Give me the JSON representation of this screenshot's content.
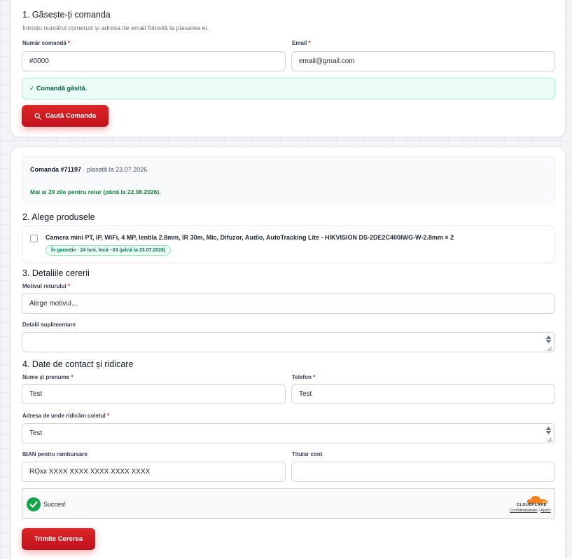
{
  "find_order": {
    "title": "1. Găsește-ți comanda",
    "hint": "Introdu numărul comenzii și adresa de email folosită la plasarea ei.",
    "order_label": "Număr comandă",
    "order_value": "#0000",
    "email_label": "Email",
    "email_value": "email@gmail.com",
    "required_mark": "*",
    "found_message": "✓ Comandă găsită.",
    "search_button": "Caută Comanda",
    "search_icon": "search-icon"
  },
  "order": {
    "title": "Comanda #71197",
    "placed": "· plasată la 23.07.2026",
    "return_window": "Mai ai 29 zile pentru retur (până la 22.08.2026)."
  },
  "products": {
    "title": "2. Alege produsele",
    "items": [
      {
        "name": "Camera mini PT, IP, WiFi, 4 MP, lentila 2.8mm, IR 30m, Mic, Difuzor, Audio, AutoTracking Lite - HIKVISION DS-2DE2C400IWG-W-2.8mm × 2",
        "warranty": "În garanție · 24 luni, încă ~24 (până la 23.07.2028)",
        "checked": false
      }
    ]
  },
  "request": {
    "title": "3. Detaliile cererii",
    "reason_label": "Motivul returului",
    "reason_value": "Alege motivul...",
    "details_label": "Detalii suplimentare",
    "details_value": ""
  },
  "contact": {
    "title": "4. Date de contact și ridicare",
    "name_label": "Nume și prenume",
    "name_value": "Test",
    "phone_label": "Telefon",
    "phone_value": "Test",
    "address_label": "Adresa de unde ridicăm coletul",
    "address_value": "Test",
    "iban_label": "IBAN pentru rambursare",
    "iban_placeholder": "ROxx XXXX XXXX XXXX XXXX XXXX",
    "holder_label": "Titular cont",
    "holder_value": ""
  },
  "captcha": {
    "status": "Succes!",
    "brand": "CLOUDFLARE",
    "privacy": "Confidențialitate",
    "separator": "•",
    "help": "Ajutor"
  },
  "submit_button": "Trimite Cererea",
  "colors": {
    "accent": "#dc2626",
    "success_bg": "#ecfdf5",
    "success_text": "#065f46",
    "order_green": "#15803d",
    "cloudflare_orange": "#f48120"
  }
}
